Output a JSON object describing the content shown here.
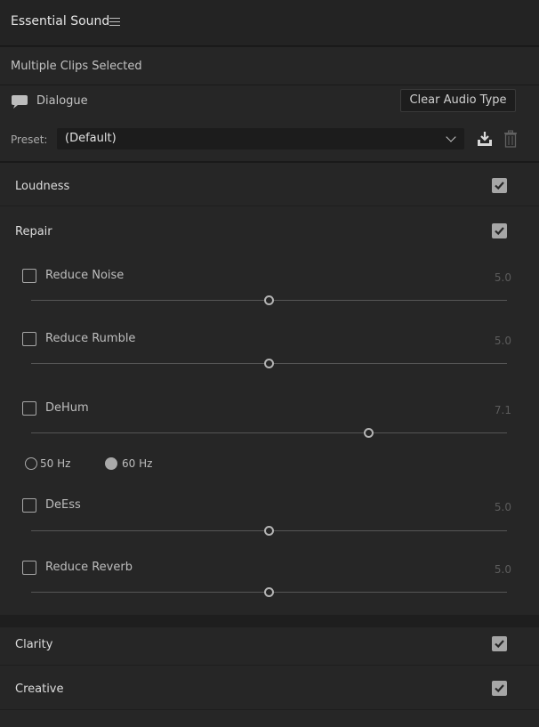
{
  "header": {
    "title": "Essential Sound",
    "menu_icon": "hamburger-menu-icon"
  },
  "clips_status": "Multiple Clips Selected",
  "audio_type": {
    "icon": "speech-bubble-icon",
    "label": "Dialogue",
    "clear_button": "Clear Audio Type"
  },
  "preset": {
    "label": "Preset:",
    "value": "(Default)",
    "dropdown_icon": "chevron-down-icon",
    "save_icon": "save-preset-icon",
    "delete_icon": "trash-icon"
  },
  "sections": {
    "loudness": {
      "title": "Loudness",
      "checked": true
    },
    "repair": {
      "title": "Repair",
      "checked": true
    },
    "clarity": {
      "title": "Clarity",
      "checked": true
    },
    "creative": {
      "title": "Creative",
      "checked": true
    }
  },
  "repair_items": {
    "reduce_noise": {
      "label": "Reduce Noise",
      "value": "5.0",
      "checked": false,
      "level": 5.0,
      "max": 10
    },
    "reduce_rumble": {
      "label": "Reduce Rumble",
      "value": "5.0",
      "checked": false,
      "level": 5.0,
      "max": 10
    },
    "dehum": {
      "label": "DeHum",
      "value": "7.1",
      "checked": false,
      "level": 7.1,
      "max": 10
    },
    "deess": {
      "label": "DeEss",
      "value": "5.0",
      "checked": false,
      "level": 5.0,
      "max": 10
    },
    "reduce_reverb": {
      "label": "Reduce Reverb",
      "value": "5.0",
      "checked": false,
      "level": 5.0,
      "max": 10
    }
  },
  "hum_frequency": {
    "options": [
      "50 Hz",
      "60 Hz"
    ],
    "selected": "60 Hz"
  },
  "colors": {
    "background": "#262626",
    "header": "#232323",
    "text": "#c9c9c9",
    "checkbox_fill": "#a6a6a6",
    "slider_track": "#555555"
  }
}
